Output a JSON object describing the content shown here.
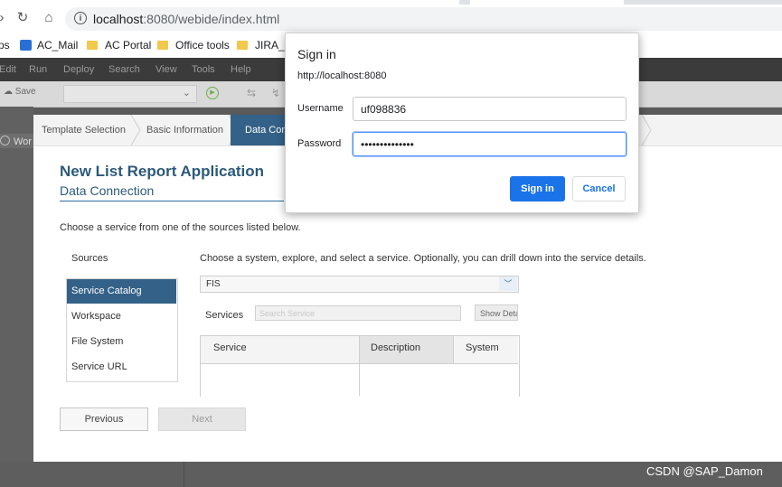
{
  "browser": {
    "url_host": "localhost",
    "url_rest": ":8080/webide/index.html",
    "bookmarks": [
      {
        "label": "ps"
      },
      {
        "label": "AC_Mail"
      },
      {
        "label": "AC Portal"
      },
      {
        "label": "Office tools"
      },
      {
        "label": "JIRA_JI"
      }
    ]
  },
  "ide": {
    "menu": [
      "Edit",
      "Run",
      "Deploy",
      "Search",
      "View",
      "Tools",
      "Help"
    ],
    "save_label": "Save",
    "workspace_label": "Wor"
  },
  "wizard": {
    "steps": [
      "Template Selection",
      "Basic Information",
      "Data Con"
    ],
    "title": "New List Report Application",
    "subtitle": "Data Connection",
    "instructions": "Choose a service from one of the sources listed below.",
    "sources_label": "Sources",
    "sources_desc": "Choose a system, explore, and select a service. Optionally, you can drill down into the service details.",
    "sources": [
      "Service Catalog",
      "Workspace",
      "File System",
      "Service URL"
    ],
    "selected_source": "Service Catalog",
    "system_value": "FIS",
    "services_label": "Services",
    "search_placeholder": "Search Service",
    "show_details": "Show Details",
    "table_headers": [
      "Service",
      "Description",
      "System"
    ],
    "prev_label": "Previous",
    "next_label": "Next"
  },
  "dialog": {
    "title": "Sign in",
    "origin": "http://localhost:8080",
    "username_label": "Username",
    "username_value": "uf098836",
    "password_label": "Password",
    "password_value": "••••••••••••••",
    "signin_label": "Sign in",
    "cancel_label": "Cancel"
  },
  "watermark": "CSDN @SAP_Damon",
  "colors": {
    "accent": "#346187",
    "button_primary": "#1a73e8",
    "title_blue": "#2c5a7a"
  }
}
